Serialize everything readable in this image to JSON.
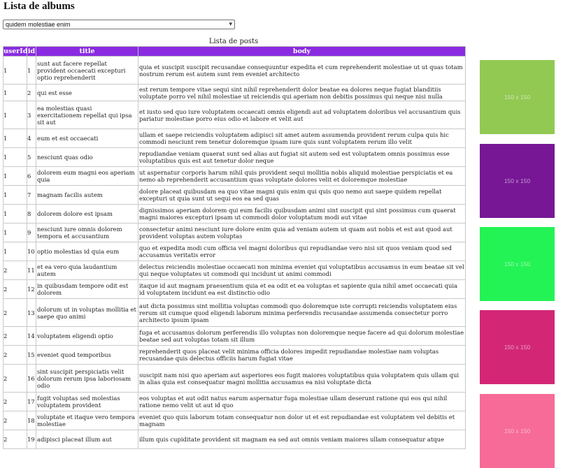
{
  "page": {
    "title": "Lista de albums"
  },
  "album_select": {
    "value": "quidem molestiae enim",
    "chevron": "▾"
  },
  "table": {
    "caption": "Lista de posts",
    "headers": {
      "userId": "userId",
      "id": "id",
      "title": "title",
      "body": "body"
    },
    "rows": [
      {
        "userId": "1",
        "id": "1",
        "title": "sunt aut facere repellat provident occaecati excepturi optio reprehenderit",
        "body": "quia et suscipit suscipit recusandae consequuntur expedita et cum reprehenderit molestiae ut ut quas totam nostrum rerum est autem sunt rem eveniet architecto"
      },
      {
        "userId": "1",
        "id": "2",
        "title": "qui est esse",
        "body": "est rerum tempore vitae sequi sint nihil reprehenderit dolor beatae ea dolores neque fugiat blanditiis voluptate porro vel nihil molestiae ut reiciendis qui aperiam non debitis possimus qui neque nisi nulla"
      },
      {
        "userId": "1",
        "id": "3",
        "title": "ea molestias quasi exercitationem repellat qui ipsa sit aut",
        "body": "et iusto sed quo iure voluptatem occaecati omnis eligendi aut ad voluptatem doloribus vel accusantium quis pariatur molestiae porro eius odio et labore et velit aut"
      },
      {
        "userId": "1",
        "id": "4",
        "title": "eum et est occaecati",
        "body": "ullam et saepe reiciendis voluptatem adipisci sit amet autem assumenda provident rerum culpa quis hic commodi nesciunt rem tenetur doloremque ipsam iure quis sunt voluptatem rerum illo velit"
      },
      {
        "userId": "1",
        "id": "5",
        "title": "nesciunt quas odio",
        "body": "repudiandae veniam quaerat sunt sed alias aut fugiat sit autem sed est voluptatem omnis possimus esse voluptatibus quis est aut tenetur dolor neque"
      },
      {
        "userId": "1",
        "id": "6",
        "title": "dolorem eum magni eos aperiam quia",
        "body": "ut aspernatur corporis harum nihil quis provident sequi mollitia nobis aliquid molestiae perspiciatis et ea nemo ab reprehenderit accusantium quas voluptate dolores velit et doloremque molestiae"
      },
      {
        "userId": "1",
        "id": "7",
        "title": "magnam facilis autem",
        "body": "dolore placeat quibusdam ea quo vitae magni quis enim qui quis quo nemo aut saepe quidem repellat excepturi ut quia sunt ut sequi eos ea sed quas"
      },
      {
        "userId": "1",
        "id": "8",
        "title": "dolorem dolore est ipsam",
        "body": "dignissimos aperiam dolorem qui eum facilis quibusdam animi sint suscipit qui sint possimus cum quaerat magni maiores excepturi ipsam ut commodi dolor voluptatum modi aut vitae"
      },
      {
        "userId": "1",
        "id": "9",
        "title": "nesciunt iure omnis dolorem tempora et accusantium",
        "body": "consectetur animi nesciunt iure dolore enim quia ad veniam autem ut quam aut nobis et est aut quod aut provident voluptas autem voluptas"
      },
      {
        "userId": "1",
        "id": "10",
        "title": "optio molestias id quia eum",
        "body": "quo et expedita modi cum officia vel magni doloribus qui repudiandae vero nisi sit quos veniam quod sed accusamus veritatis error"
      },
      {
        "userId": "2",
        "id": "11",
        "title": "et ea vero quia laudantium autem",
        "body": "delectus reiciendis molestiae occaecati non minima eveniet qui voluptatibus accusamus in eum beatae sit vel qui neque voluptates ut commodi qui incidunt ut animi commodi"
      },
      {
        "userId": "2",
        "id": "12",
        "title": "in quibusdam tempore odit est dolorem",
        "body": "itaque id aut magnam praesentium quia et ea odit et ea voluptas et sapiente quia nihil amet occaecati quia id voluptatem incidunt ea est distinctio odio"
      },
      {
        "userId": "2",
        "id": "13",
        "title": "dolorum ut in voluptas mollitia et saepe quo animi",
        "body": "aut dicta possimus sint mollitia voluptas commodi quo doloremque iste corrupti reiciendis voluptatem eius rerum sit cumque quod eligendi laborum minima perferendis recusandae assumenda consectetur porro architecto ipsum ipsam"
      },
      {
        "userId": "2",
        "id": "14",
        "title": "voluptatem eligendi optio",
        "body": "fuga et accusamus dolorum perferendis illo voluptas non doloremque neque facere ad qui dolorum molestiae beatae sed aut voluptas totam sit illum"
      },
      {
        "userId": "2",
        "id": "15",
        "title": "eveniet quod temporibus",
        "body": "reprehenderit quos placeat velit minima officia dolores impedit repudiandae molestiae nam voluptas recusandae quis delectus officiis harum fugiat vitae"
      },
      {
        "userId": "2",
        "id": "16",
        "title": "sint suscipit perspiciatis velit dolorum rerum ipsa laboriosam odio",
        "body": "suscipit nam nisi quo aperiam aut asperiores eos fugit maiores voluptatibus quia voluptatem quis ullam qui in alias quia est consequatur magni mollitia accusamus ea nisi voluptate dicta"
      },
      {
        "userId": "2",
        "id": "17",
        "title": "fugit voluptas sed molestias voluptatem provident",
        "body": "eos voluptas et aut odit natus earum aspernatur fuga molestiae ullam deserunt ratione qui eos qui nihil ratione nemo velit ut aut id quo"
      },
      {
        "userId": "2",
        "id": "18",
        "title": "voluptate et itaque vero tempora molestiae",
        "body": "eveniet quo quis laborum totam consequatur non dolor ut et est repudiandae est voluptatem vel debitis et magnam"
      },
      {
        "userId": "2",
        "id": "19",
        "title": "adipisci placeat illum aut",
        "body": "illum quis cupiditate provident sit magnam ea sed aut omnis veniam maiores ullam consequatur atque"
      }
    ]
  },
  "thumbnails": [
    {
      "label": "150 x 150",
      "color": "#92c952"
    },
    {
      "label": "150 x 150",
      "color": "#771796"
    },
    {
      "label": "150 x 150",
      "color": "#24f355"
    },
    {
      "label": "150 x 150",
      "color": "#d32776"
    },
    {
      "label": "150 x 150",
      "color": "#f66b97"
    }
  ]
}
